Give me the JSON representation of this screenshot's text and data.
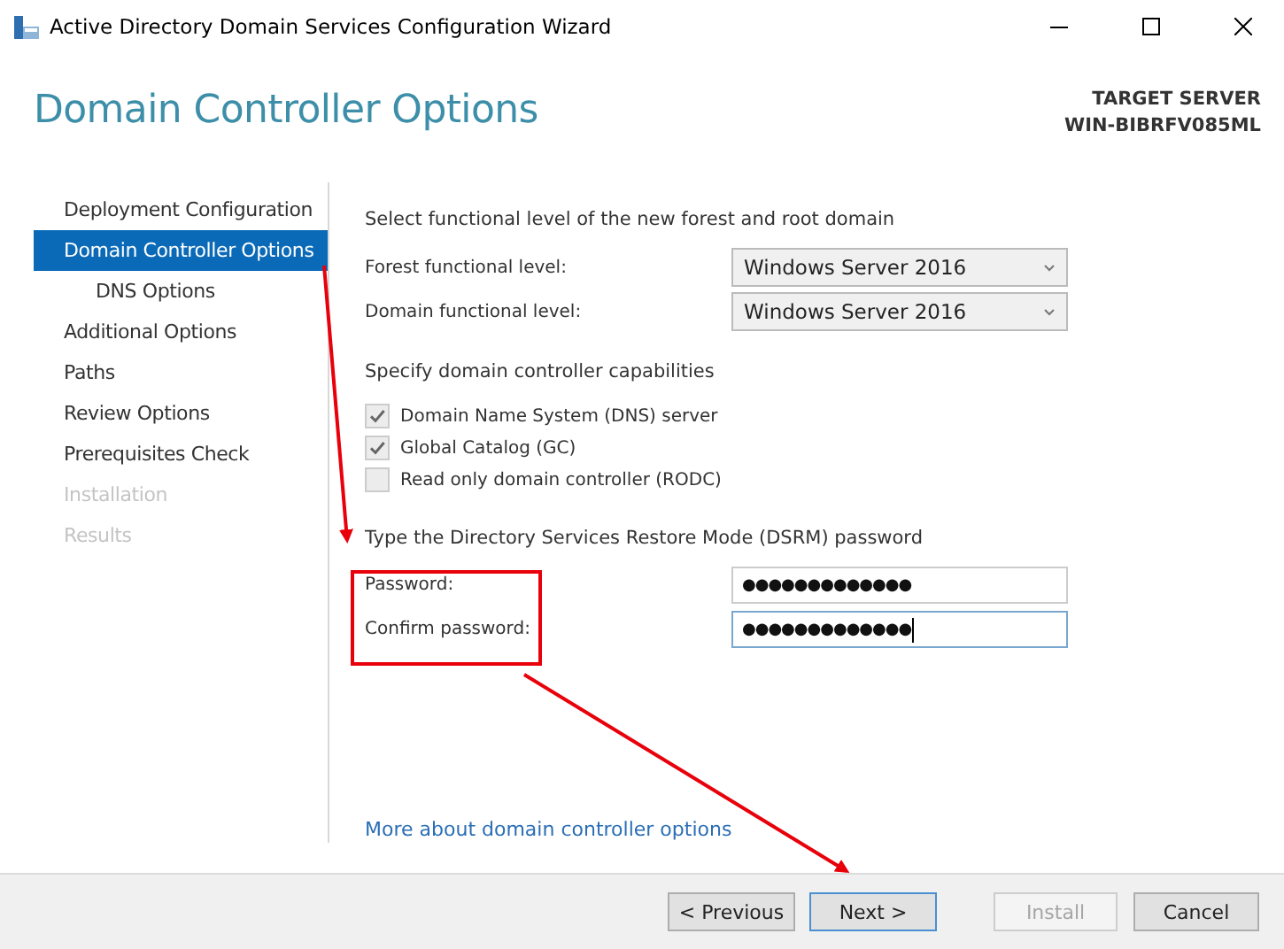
{
  "window": {
    "title": "Active Directory Domain Services Configuration Wizard"
  },
  "header": {
    "title": "Domain Controller Options",
    "target_label": "TARGET SERVER",
    "target_name": "WIN-BIBRFV085ML"
  },
  "sidebar": {
    "items": [
      {
        "label": "Deployment Configuration",
        "selected": false,
        "disabled": false
      },
      {
        "label": "Domain Controller Options",
        "selected": true,
        "disabled": false,
        "children": [
          {
            "label": "DNS Options",
            "selected": false,
            "disabled": false
          }
        ]
      },
      {
        "label": "Additional Options",
        "selected": false,
        "disabled": false
      },
      {
        "label": "Paths",
        "selected": false,
        "disabled": false
      },
      {
        "label": "Review Options",
        "selected": false,
        "disabled": false
      },
      {
        "label": "Prerequisites Check",
        "selected": false,
        "disabled": false
      },
      {
        "label": "Installation",
        "selected": false,
        "disabled": true
      },
      {
        "label": "Results",
        "selected": false,
        "disabled": true
      }
    ]
  },
  "functional_levels": {
    "heading": "Select functional level of the new forest and root domain",
    "fields": [
      {
        "label": "Forest functional level:",
        "value": "Windows Server 2016"
      },
      {
        "label": "Domain functional level:",
        "value": "Windows Server 2016"
      }
    ]
  },
  "capabilities": {
    "heading": "Specify domain controller capabilities",
    "options": [
      {
        "label": "Domain Name System (DNS) server",
        "checked": true
      },
      {
        "label": "Global Catalog (GC)",
        "checked": true
      },
      {
        "label": "Read only domain controller (RODC)",
        "checked": false
      }
    ]
  },
  "dsrm": {
    "heading": "Type the Directory Services Restore Mode (DSRM) password",
    "fields": [
      {
        "label": "Password:",
        "value": "●●●●●●●●●●●●●",
        "focused": false
      },
      {
        "label": "Confirm password:",
        "value": "●●●●●●●●●●●●●",
        "focused": true
      }
    ]
  },
  "link": "More about domain controller options",
  "buttons": [
    {
      "label": "< Previous",
      "disabled": false,
      "default": false
    },
    {
      "label": "Next >",
      "disabled": false,
      "default": true
    },
    {
      "label": "Install",
      "disabled": true,
      "default": false
    },
    {
      "label": "Cancel",
      "disabled": false,
      "default": false
    }
  ]
}
